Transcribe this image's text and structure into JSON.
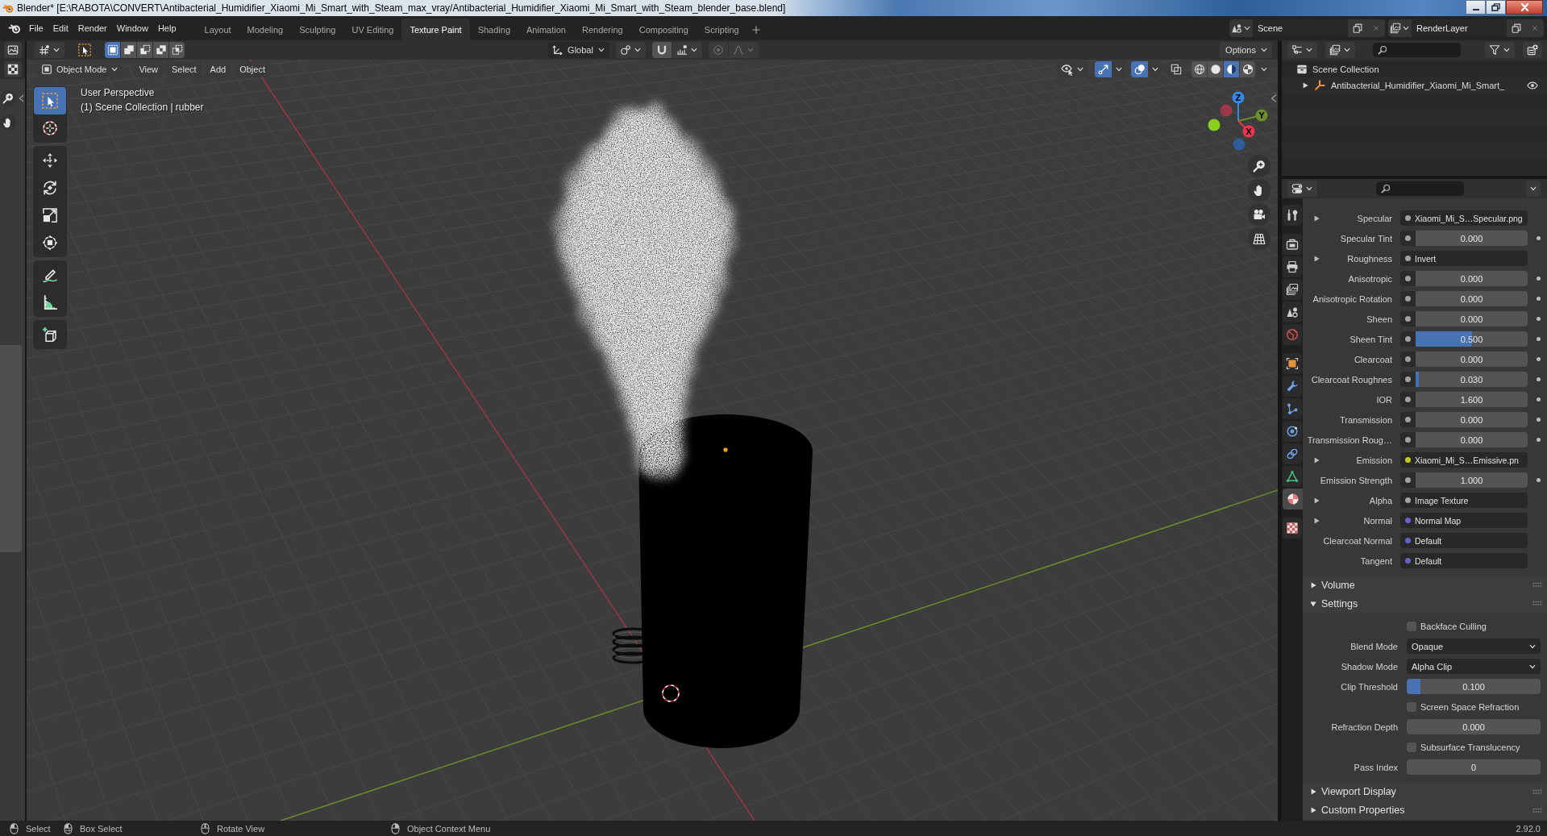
{
  "window": {
    "title": "Blender* [E:\\RABOTA\\CONVERT\\Antibacterial_Humidifier_Xiaomi_Mi_Smart_with_Steam_max_vray/Antibacterial_Humidifier_Xiaomi_Mi_Smart_with_Steam_blender_base.blend]"
  },
  "menu": [
    "File",
    "Edit",
    "Render",
    "Window",
    "Help"
  ],
  "workspaces": [
    {
      "label": "Layout",
      "selected": false
    },
    {
      "label": "Modeling",
      "selected": false
    },
    {
      "label": "Sculpting",
      "selected": false
    },
    {
      "label": "UV Editing",
      "selected": false
    },
    {
      "label": "Texture Paint",
      "selected": true
    },
    {
      "label": "Shading",
      "selected": false
    },
    {
      "label": "Animation",
      "selected": false
    },
    {
      "label": "Rendering",
      "selected": false
    },
    {
      "label": "Compositing",
      "selected": false
    },
    {
      "label": "Scripting",
      "selected": false
    }
  ],
  "scene": {
    "value": "Scene"
  },
  "view_layer": {
    "value": "RenderLayer"
  },
  "tool_header": {
    "select_modes": [
      {
        "kind": "set",
        "selected": true
      },
      {
        "kind": "extend",
        "selected": false
      },
      {
        "kind": "subtract",
        "selected": false
      },
      {
        "kind": "difference",
        "selected": false
      },
      {
        "kind": "intersect",
        "selected": false
      }
    ],
    "orientation": "Global",
    "options": "Options"
  },
  "viewport_header": {
    "mode": "Object Mode",
    "menus": [
      "View",
      "Select",
      "Add",
      "Object"
    ],
    "toggles": [
      {
        "kind": "gizmos",
        "on": true
      },
      {
        "kind": "overlays",
        "on": true
      },
      {
        "kind": "xray",
        "on": false
      }
    ],
    "shading": [
      {
        "kind": "wireframe",
        "selected": false
      },
      {
        "kind": "solid",
        "selected": false
      },
      {
        "kind": "material",
        "selected": true
      },
      {
        "kind": "rendered",
        "selected": false
      }
    ]
  },
  "viewport": {
    "view_name": "User Perspective",
    "context": "(1) Scene Collection | rubber",
    "tool_groups": [
      [
        {
          "kind": "select_box",
          "selected": true
        },
        {
          "kind": "cursor",
          "selected": false
        }
      ],
      [
        {
          "kind": "move",
          "selected": false
        },
        {
          "kind": "rotate",
          "selected": false
        },
        {
          "kind": "scale",
          "selected": false
        },
        {
          "kind": "transform",
          "selected": false
        }
      ],
      [
        {
          "kind": "annotate",
          "selected": false
        },
        {
          "kind": "measure",
          "selected": false
        }
      ],
      [
        {
          "kind": "add_cube",
          "selected": false
        }
      ]
    ],
    "gizmo": [
      {
        "kind": "positive",
        "label": "Z",
        "color": "#2f8ae8"
      },
      {
        "kind": "positive",
        "label": "Y",
        "color": "#6b8f2b"
      },
      {
        "kind": "positive",
        "label": "X",
        "color": "#f2334f"
      },
      {
        "kind": "negative",
        "color": "#8acf1b"
      },
      {
        "kind": "negative",
        "color": "#9d3647"
      },
      {
        "kind": "negative",
        "color": "#2d5e9b"
      }
    ]
  },
  "outliner": {
    "tree": [
      {
        "label": "Scene Collection",
        "children": [
          {
            "label": "Antibacterial_Humidifier_Xiaomi_Mi_Smart_",
            "expanded": false,
            "visible": true
          }
        ]
      }
    ]
  },
  "properties": {
    "tab_groups": [
      [
        {
          "kind": "tool",
          "selected": false
        }
      ],
      [
        {
          "kind": "render",
          "selected": false
        },
        {
          "kind": "output",
          "selected": false
        },
        {
          "kind": "view_layer",
          "selected": false
        },
        {
          "kind": "scene",
          "selected": false
        },
        {
          "kind": "world",
          "selected": false
        }
      ],
      [
        {
          "kind": "object",
          "selected": false
        },
        {
          "kind": "modifiers",
          "selected": false
        },
        {
          "kind": "particles",
          "selected": false
        },
        {
          "kind": "physics",
          "selected": false
        },
        {
          "kind": "constraints",
          "selected": false
        },
        {
          "kind": "data",
          "selected": false
        },
        {
          "kind": "material",
          "selected": true
        }
      ],
      [
        {
          "kind": "texture",
          "selected": false
        }
      ]
    ],
    "rows": [
      {
        "label": "Specular",
        "kind": "link",
        "color": "#a1a1a1",
        "value": "Xiaomi_Mi_S…Specular.png",
        "expanded": false
      },
      {
        "label": "Specular Tint",
        "kind": "number",
        "color": "#a1a1a1",
        "value": "0.000"
      },
      {
        "label": "Roughness",
        "kind": "link",
        "color": "#a1a1a1",
        "value": "Invert",
        "expanded": false
      },
      {
        "label": "Anisotropic",
        "kind": "number",
        "color": "#a1a1a1",
        "value": "0.000"
      },
      {
        "label": "Anisotropic Rotation",
        "kind": "number",
        "color": "#a1a1a1",
        "value": "0.000"
      },
      {
        "label": "Sheen",
        "kind": "number",
        "color": "#a1a1a1",
        "value": "0.000"
      },
      {
        "label": "Sheen Tint",
        "kind": "slider",
        "color": "#a1a1a1",
        "value": "0.500",
        "level": 0.5
      },
      {
        "label": "Clearcoat",
        "kind": "number",
        "color": "#a1a1a1",
        "value": "0.000"
      },
      {
        "label": "Clearcoat Roughnes",
        "kind": "slider",
        "color": "#a1a1a1",
        "value": "0.030",
        "level": 0.03
      },
      {
        "label": "IOR",
        "kind": "number",
        "color": "#a1a1a1",
        "value": "1.600"
      },
      {
        "label": "Transmission",
        "kind": "number",
        "color": "#a1a1a1",
        "value": "0.000"
      },
      {
        "label": "Transmission Roug…",
        "kind": "number",
        "color": "#a1a1a1",
        "value": "0.000"
      },
      {
        "label": "Emission",
        "kind": "link",
        "color": "#c7c729",
        "value": "Xiaomi_Mi_S…Emissive.pn",
        "expanded": false
      },
      {
        "label": "Emission Strength",
        "kind": "number",
        "color": "#a1a1a1",
        "value": "1.000"
      },
      {
        "label": "Alpha",
        "kind": "link",
        "color": "#a1a1a1",
        "value": "Image Texture",
        "expanded": false
      },
      {
        "label": "Normal",
        "kind": "link",
        "color": "#6363c7",
        "value": "Normal Map",
        "expanded": false
      },
      {
        "label": "Clearcoat Normal",
        "kind": "input",
        "color": "#6363c7",
        "value": "Default"
      },
      {
        "label": "Tangent",
        "kind": "input",
        "color": "#6363c7",
        "value": "Default"
      }
    ],
    "panels": [
      {
        "title": "Volume",
        "expanded": false
      },
      {
        "title": "Settings",
        "expanded": true,
        "rows": [
          {
            "kind": "checkbox",
            "label": "Backface Culling",
            "checked": false
          },
          {
            "kind": "dropdown",
            "label": "Blend Mode",
            "value": "Opaque"
          },
          {
            "kind": "dropdown",
            "label": "Shadow Mode",
            "value": "Alpha Clip"
          },
          {
            "kind": "slider",
            "label": "Clip Threshold",
            "value": "0.100",
            "level": 0.1
          },
          {
            "kind": "checkbox",
            "label": "Screen Space Refraction",
            "checked": false
          },
          {
            "kind": "number",
            "label": "Refraction Depth",
            "value": "0.000"
          },
          {
            "kind": "checkbox",
            "label": "Subsurface Translucency",
            "checked": false
          },
          {
            "kind": "number",
            "label": "Pass Index",
            "value": "0"
          }
        ]
      },
      {
        "title": "Viewport Display",
        "expanded": false
      },
      {
        "title": "Custom Properties",
        "expanded": false
      }
    ]
  },
  "status_bar": {
    "hints": [
      {
        "kind": "left_click",
        "label": "Select"
      },
      {
        "kind": "left_drag",
        "label": "Box Select"
      },
      {
        "kind": "middle_click",
        "label": "Rotate View"
      },
      {
        "kind": "right_click",
        "label": "Object Context Menu"
      }
    ],
    "version": "2.92.0"
  }
}
